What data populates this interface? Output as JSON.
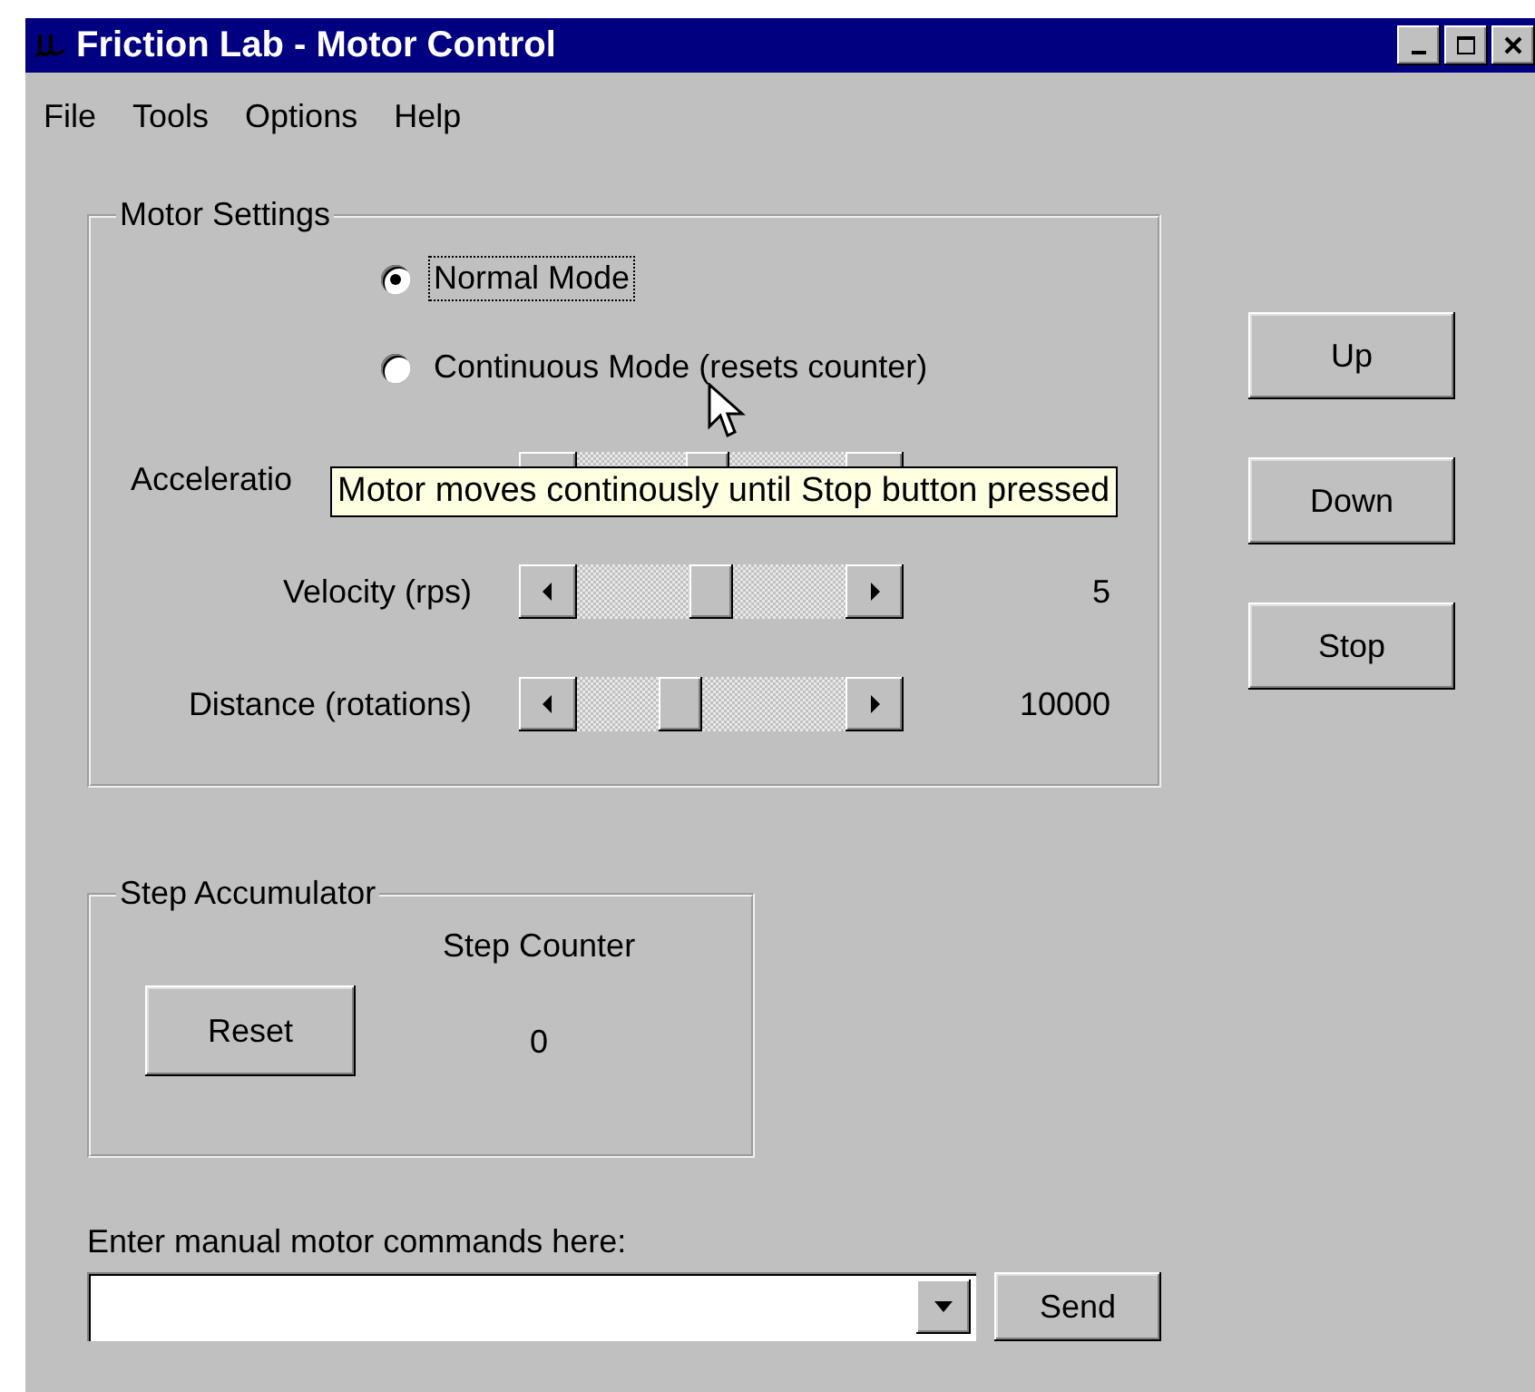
{
  "window": {
    "title": "Friction Lab - Motor Control"
  },
  "menu": [
    "File",
    "Tools",
    "Options",
    "Help"
  ],
  "motor_settings": {
    "title": "Motor Settings",
    "modes": [
      {
        "label": "Normal Mode",
        "selected": true,
        "focused": true
      },
      {
        "label": "Continuous Mode (resets counter)",
        "selected": false,
        "focused": false
      }
    ],
    "sliders": [
      {
        "label": "Acceleratio",
        "level": 0.48
      },
      {
        "label": "Velocity (rps)",
        "level": 0.5,
        "reading": "5"
      },
      {
        "label": "Distance (rotations)",
        "level": 0.36,
        "reading": "10000"
      }
    ],
    "tooltip": "Motor moves continously until Stop button pressed"
  },
  "buttons": [
    "Up",
    "Down",
    "Stop"
  ],
  "step_accumulator": {
    "title": "Step Accumulator",
    "counter_label": "Step Counter",
    "button": "Reset",
    "count": "0"
  },
  "command": {
    "label": "Enter manual motor commands here:",
    "button": "Send"
  }
}
